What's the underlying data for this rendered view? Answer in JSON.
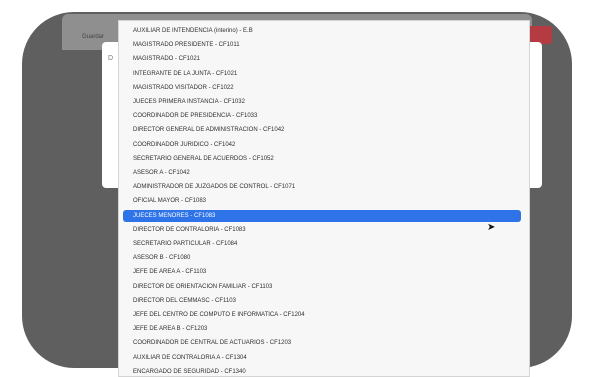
{
  "background": {
    "top_label": "Guardar",
    "modal_left_label": "D",
    "modal_close": "×"
  },
  "dropdown": {
    "options": [
      "AUXILIAR DE INTENDENCIA (interino) - E.B",
      "MAGISTRADO PRESIDENTE - CF1011",
      "MAGISTRADO - CF1021",
      "INTEGRANTE DE LA JUNTA - CF1021",
      "MAGISTRADO VISITADOR - CF1022",
      "JUECES PRIMERA INSTANCIA - CF1032",
      "COORDINADOR DE PRESIDENCIA - CF1033",
      "DIRECTOR GENERAL DE ADMINISTRACION - CF1042",
      "COORDINADOR JURIDICO - CF1042",
      "SECRETARIO GENERAL DE ACUERDOS - CF1052",
      "ASESOR A - CF1042",
      "ADMINISTRADOR DE JUZGADOS DE CONTROL - CF1071",
      "OFICIAL MAYOR - CF1083",
      "JUECES MENORES - CF1083",
      "DIRECTOR DE CONTRALORIA - CF1083",
      "SECRETARIO PARTICULAR - CF1084",
      "ASESOR B - CF1080",
      "JEFE DE AREA A - CF1103",
      "DIRECTOR DE ORIENTACION FAMILIAR - CF1103",
      "DIRECTOR DEL CEMMASC - CF1103",
      "JEFE DEL CENTRO DE COMPUTO E INFORMATICA - CF1204",
      "JEFE DE AREA B - CF1203",
      "COORDINADOR DE CENTRAL DE ACTUARIOS - CF1203",
      "AUXILIAR DE CONTRALORIA A - CF1304",
      "ENCARGADO DE SEGURIDAD - CF1340"
    ],
    "selected_index": 13
  },
  "colors": {
    "selected": "#2e73e8",
    "frame": "#5f5f5f",
    "accent_button": "#b53b42"
  }
}
